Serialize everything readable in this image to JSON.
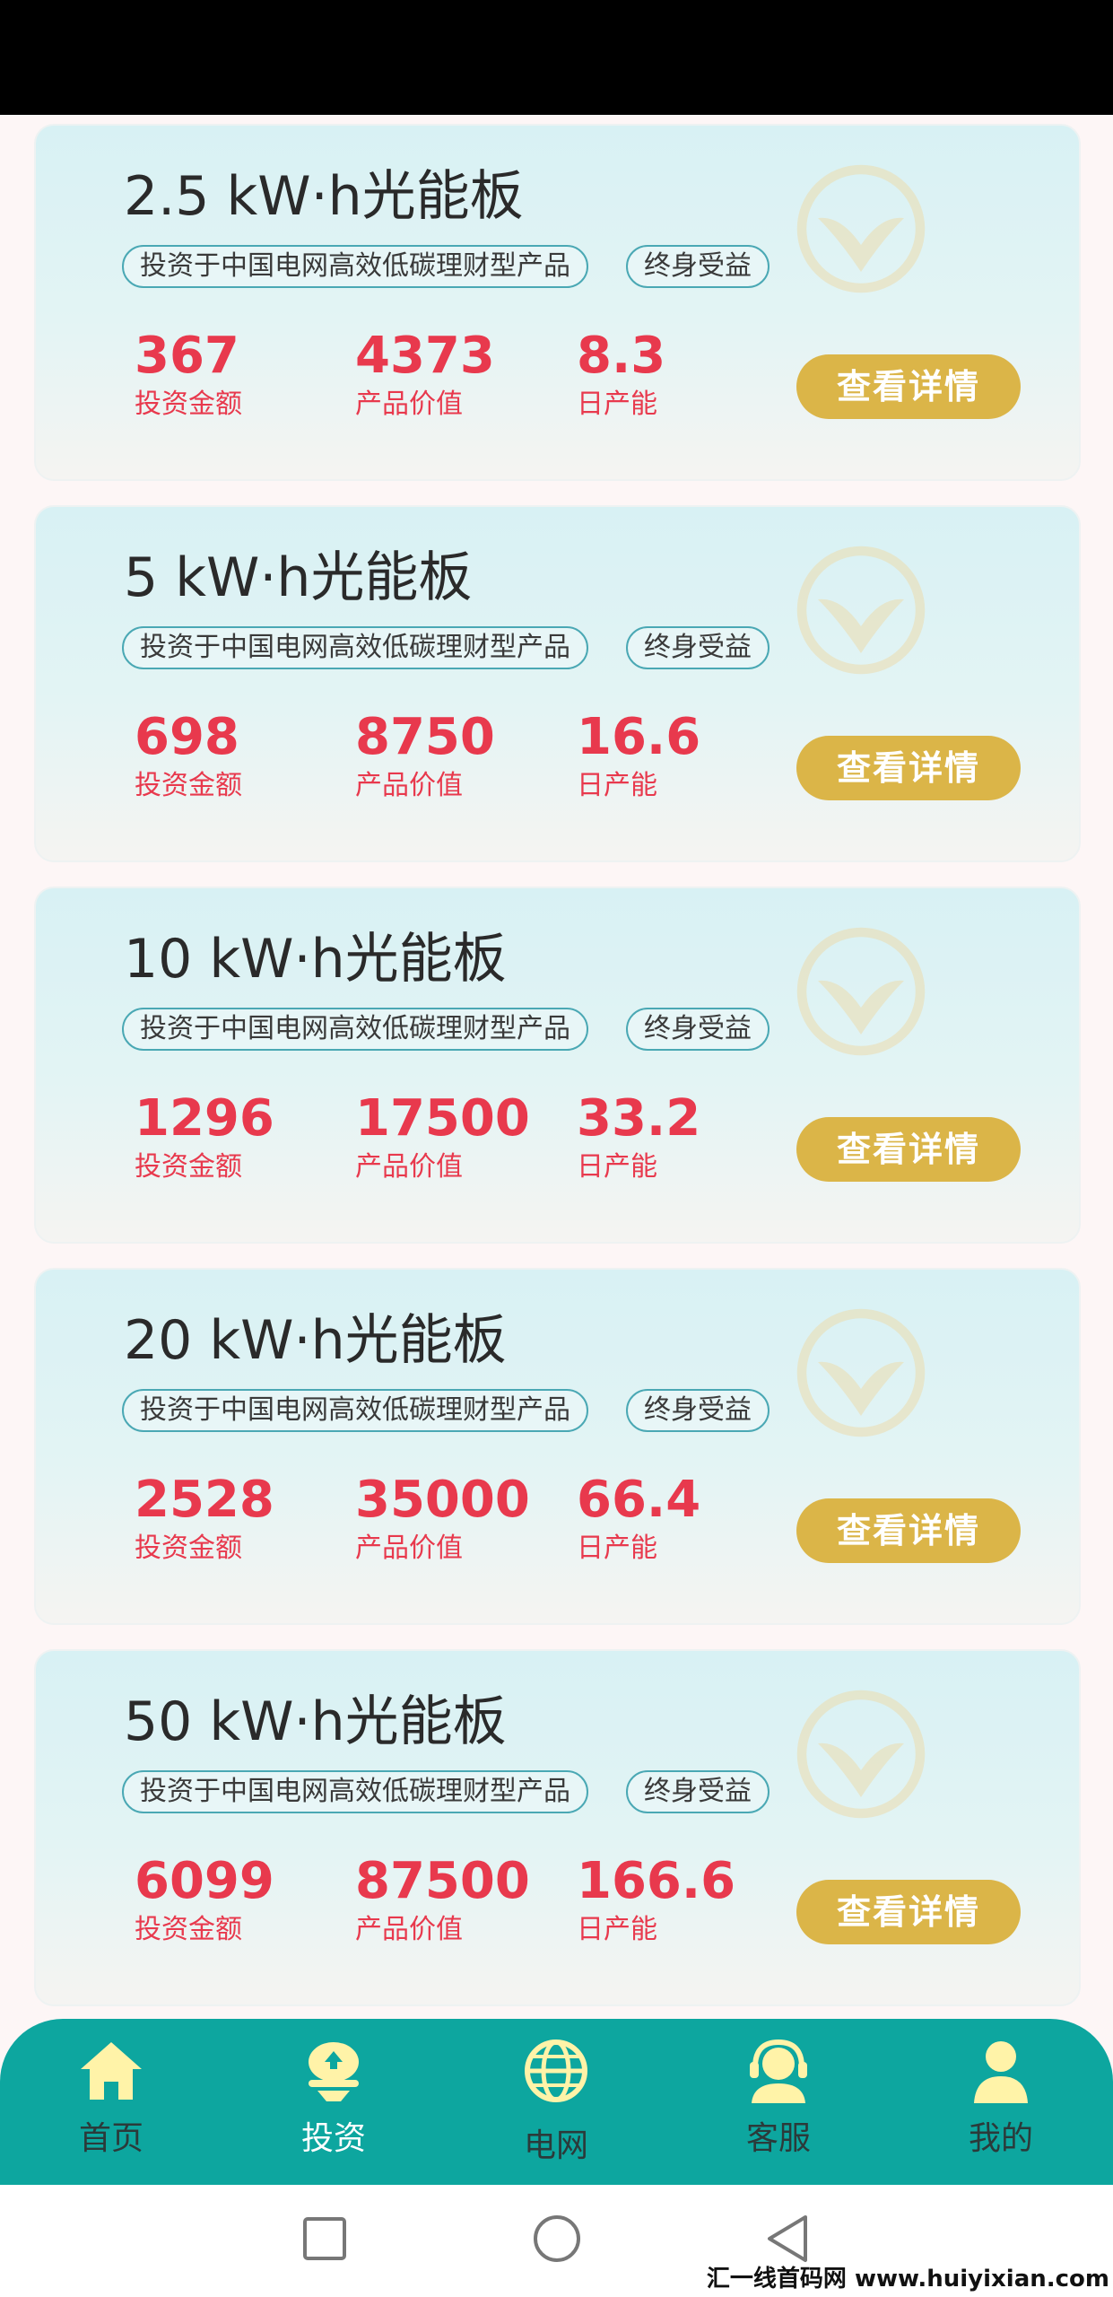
{
  "products": [
    {
      "title": "2.5 kW·h光能板",
      "tag1": "投资于中国电网高效低碳理财型产品",
      "tag2": "终身受益",
      "amount": "367",
      "amount_label": "投资金额",
      "value": "4373",
      "value_label": "产品价值",
      "daily": "8.3",
      "daily_label": "日产能",
      "button": "查看详情"
    },
    {
      "title": "5 kW·h光能板",
      "tag1": "投资于中国电网高效低碳理财型产品",
      "tag2": "终身受益",
      "amount": "698",
      "amount_label": "投资金额",
      "value": "8750",
      "value_label": "产品价值",
      "daily": "16.6",
      "daily_label": "日产能",
      "button": "查看详情"
    },
    {
      "title": "10 kW·h光能板",
      "tag1": "投资于中国电网高效低碳理财型产品",
      "tag2": "终身受益",
      "amount": "1296",
      "amount_label": "投资金额",
      "value": "17500",
      "value_label": "产品价值",
      "daily": "33.2",
      "daily_label": "日产能",
      "button": "查看详情"
    },
    {
      "title": "20 kW·h光能板",
      "tag1": "投资于中国电网高效低碳理财型产品",
      "tag2": "终身受益",
      "amount": "2528",
      "amount_label": "投资金额",
      "value": "35000",
      "value_label": "产品价值",
      "daily": "66.4",
      "daily_label": "日产能",
      "button": "查看详情"
    },
    {
      "title": "50 kW·h光能板",
      "tag1": "投资于中国电网高效低碳理财型产品",
      "tag2": "终身受益",
      "amount": "6099",
      "amount_label": "投资金额",
      "value": "87500",
      "value_label": "产品价值",
      "daily": "166.6",
      "daily_label": "日产能",
      "button": "查看详情"
    }
  ],
  "tabbar": {
    "home": {
      "label": "首页",
      "icon": "home-icon"
    },
    "invest": {
      "label": "投资",
      "icon": "invest-icon"
    },
    "grid": {
      "label": "电网",
      "icon": "globe-icon"
    },
    "service": {
      "label": "客服",
      "icon": "headset-icon"
    },
    "mine": {
      "label": "我的",
      "icon": "user-icon"
    },
    "active": "投资"
  },
  "colors": {
    "accent_red": "#e8394d",
    "button_gold": "#dbb548",
    "tabbar_teal": "#0da69f",
    "tag_border": "#4aa8b4",
    "icon_yellow": "#fff3a8"
  },
  "system_nav": {
    "icons": [
      "square-icon",
      "circle-icon",
      "back-triangle-icon"
    ]
  },
  "footer_watermark": "汇一线首码网 www.huiyixian.com"
}
